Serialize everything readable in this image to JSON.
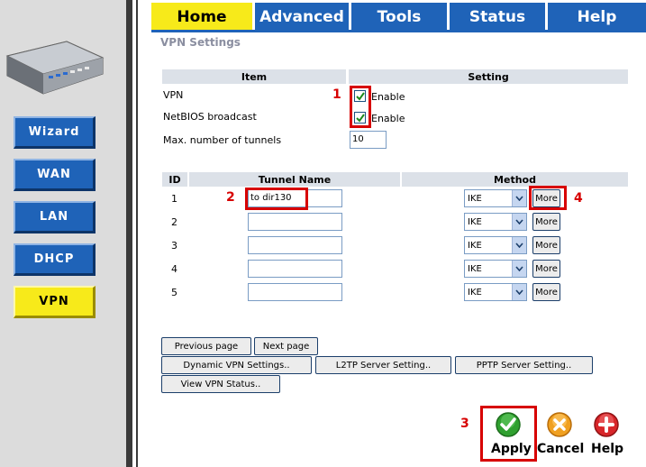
{
  "tabs": [
    {
      "label": "Home"
    },
    {
      "label": "Advanced"
    },
    {
      "label": "Tools"
    },
    {
      "label": "Status"
    },
    {
      "label": "Help"
    }
  ],
  "sidebar": {
    "items": [
      {
        "label": "Wizard"
      },
      {
        "label": "WAN"
      },
      {
        "label": "LAN"
      },
      {
        "label": "DHCP"
      },
      {
        "label": "VPN",
        "active": true
      }
    ]
  },
  "page": {
    "title": "VPN Settings",
    "settings_header": {
      "item": "Item",
      "setting": "Setting"
    },
    "vpn_label": "VPN",
    "vpn_enable": "Enable",
    "netbios_label": "NetBIOS broadcast",
    "netbios_enable": "Enable",
    "max_tunnels_label": "Max. number of tunnels",
    "max_tunnels_value": "10"
  },
  "tunnel_table": {
    "headers": {
      "id": "ID",
      "name": "Tunnel Name",
      "method": "Method"
    },
    "rows": [
      {
        "id": "1",
        "name": "to dir130",
        "method": "IKE",
        "more": "More"
      },
      {
        "id": "2",
        "name": "",
        "method": "IKE",
        "more": "More"
      },
      {
        "id": "3",
        "name": "",
        "method": "IKE",
        "more": "More"
      },
      {
        "id": "4",
        "name": "",
        "method": "IKE",
        "more": "More"
      },
      {
        "id": "5",
        "name": "",
        "method": "IKE",
        "more": "More"
      }
    ]
  },
  "buttons": {
    "prev_page": "Previous page",
    "next_page": "Next page",
    "dynamic_vpn": "Dynamic VPN Settings..",
    "l2tp": "L2TP Server Setting..",
    "pptp": "PPTP Server Setting..",
    "view_status": "View VPN Status.."
  },
  "actions": {
    "apply": "Apply",
    "cancel": "Cancel",
    "help": "Help"
  },
  "annotations": [
    "1",
    "2",
    "3",
    "4"
  ],
  "colors": {
    "tab_blue": "#1f63b8",
    "active_yellow": "#f7ea1a",
    "annotation_red": "#d70000"
  }
}
